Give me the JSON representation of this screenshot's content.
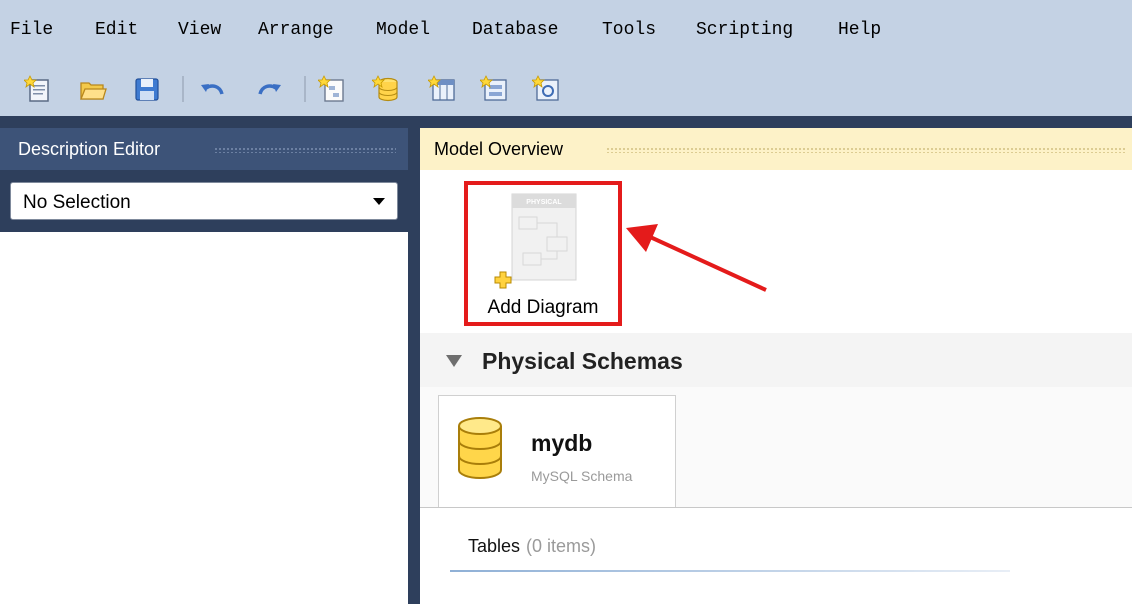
{
  "menu": [
    "File",
    "Edit",
    "View",
    "Arrange",
    "Model",
    "Database",
    "Tools",
    "Scripting",
    "Help"
  ],
  "toolbar_icons": [
    "new-document-icon",
    "open-folder-icon",
    "save-icon",
    "undo-icon",
    "redo-icon",
    "add-diagram-tool-icon",
    "add-schema-tool-icon",
    "add-table-icon",
    "add-view-icon",
    "add-routine-icon"
  ],
  "description_editor": {
    "title": "Description Editor",
    "selection_value": "No Selection"
  },
  "model_overview": {
    "title": "Model Overview",
    "add_diagram_label": "Add Diagram",
    "thumbnail_caption": "PHYSICAL"
  },
  "physical_schemas": {
    "title": "Physical Schemas",
    "schema_name": "mydb",
    "schema_type": "MySQL Schema"
  },
  "tables": {
    "label": "Tables",
    "count": "(0 items)"
  },
  "colors": {
    "menubar": "#c4d2e4",
    "frame": "#2e3f5c",
    "panel_header": "#3d5378",
    "overview_header": "#fdf2c8",
    "highlight": "#e41b1b"
  }
}
